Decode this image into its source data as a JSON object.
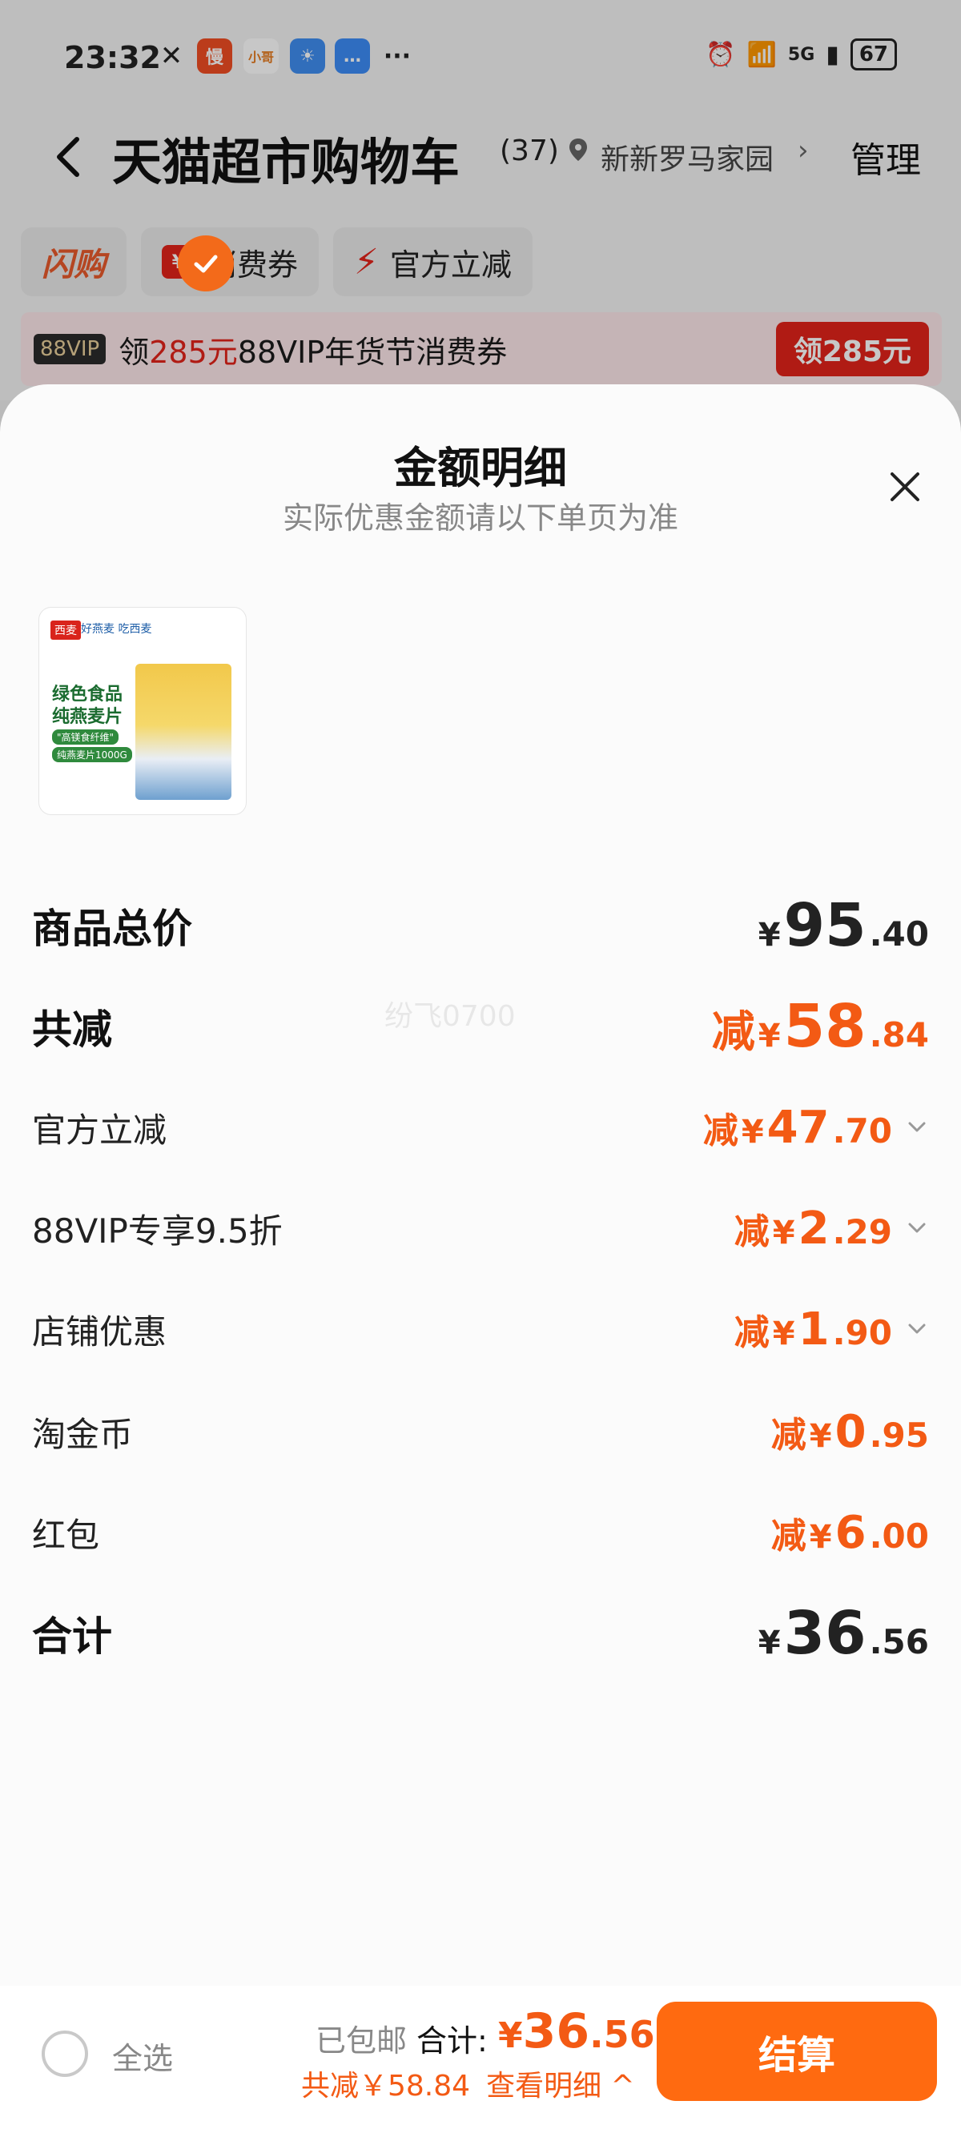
{
  "status_bar": {
    "time": "23:32",
    "app_icons": [
      "慢",
      "小哥",
      "weather",
      "msg"
    ],
    "more": "···",
    "network": "5G",
    "battery": "67"
  },
  "nav": {
    "title": "天猫超市购物车",
    "count": "(37)",
    "location": "新新罗马家园",
    "manage": "管理"
  },
  "tags": [
    {
      "label": "闪购"
    },
    {
      "label": "消费券",
      "icon": "¥"
    },
    {
      "label": "官方立减"
    }
  ],
  "promo": {
    "vip_tag": "88VIP",
    "text_pre": "领",
    "text_amount": "285元",
    "text_post": "88VIP年货节消费券",
    "button": "领285元"
  },
  "sheet": {
    "title": "金额明细",
    "subtitle": "实际优惠金额请以下单页为准",
    "watermark": "纷飞0700",
    "product": {
      "brand": "西麦",
      "slogan": "好燕麦 吃西麦",
      "line1": "绿色食品",
      "line2": "纯燕麦片",
      "tag1": "\"高镁食纤维\"",
      "tag2": "纯燕麦片1000G"
    },
    "rows": [
      {
        "label": "商品总价",
        "prefix": "",
        "yen": "¥",
        "int": "95",
        "dec": ".40"
      },
      {
        "label": "共减",
        "prefix": "减",
        "yen": "¥",
        "int": "58",
        "dec": ".84"
      },
      {
        "label": "官方立减",
        "prefix": "减",
        "yen": "¥",
        "int": "47",
        "dec": ".70"
      },
      {
        "label": "88VIP专享9.5折",
        "prefix": "减",
        "yen": "¥",
        "int": "2",
        "dec": ".29"
      },
      {
        "label": "店铺优惠",
        "prefix": "减",
        "yen": "¥",
        "int": "1",
        "dec": ".90"
      },
      {
        "label": "淘金币",
        "prefix": "减",
        "yen": "¥",
        "int": "0",
        "dec": ".95"
      },
      {
        "label": "红包",
        "prefix": "减",
        "yen": "¥",
        "int": "6",
        "dec": ".00"
      },
      {
        "label": "合计",
        "prefix": "",
        "yen": "¥",
        "int": "36",
        "dec": ".56"
      }
    ]
  },
  "bottom": {
    "select_all": "全选",
    "shipped": "已包邮",
    "total_label": "合计:",
    "total_yen": "¥",
    "total_int": "36",
    "total_dec": ".56",
    "saved": "共减￥58.84",
    "detail": "查看明细 ^",
    "checkout": "结算"
  },
  "colors": {
    "accent": "#f35a14",
    "checkout": "#ff6a10",
    "promo_red": "#e2231a"
  }
}
